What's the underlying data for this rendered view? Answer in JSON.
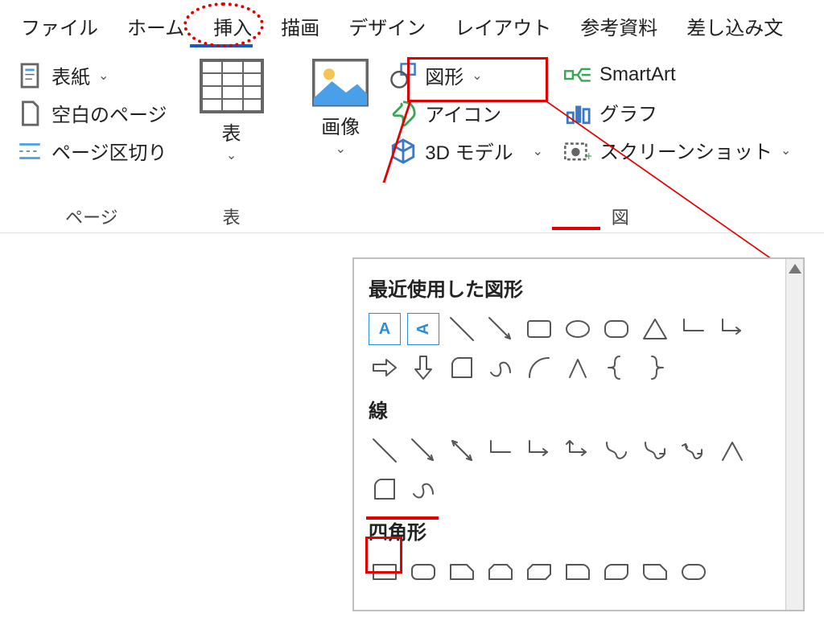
{
  "tabs": {
    "file": "ファイル",
    "home": "ホーム",
    "insert": "挿入",
    "draw": "描画",
    "design": "デザイン",
    "layout": "レイアウト",
    "references": "参考資料",
    "mailings": "差し込み文"
  },
  "groups": {
    "pages": {
      "label": "ページ",
      "cover": "表紙",
      "blank": "空白のページ",
      "break": "ページ区切り"
    },
    "tables": {
      "label": "表",
      "table": "表"
    },
    "illust": {
      "label": "図",
      "image": "画像",
      "shapes": "図形",
      "icons": "アイコン",
      "model3d": "3D モデル",
      "smartart": "SmartArt",
      "chart": "グラフ",
      "screenshot": "スクリーンショット"
    }
  },
  "dropdown": {
    "recent": "最近使用した図形",
    "lines": "線",
    "rects": "四角形"
  }
}
